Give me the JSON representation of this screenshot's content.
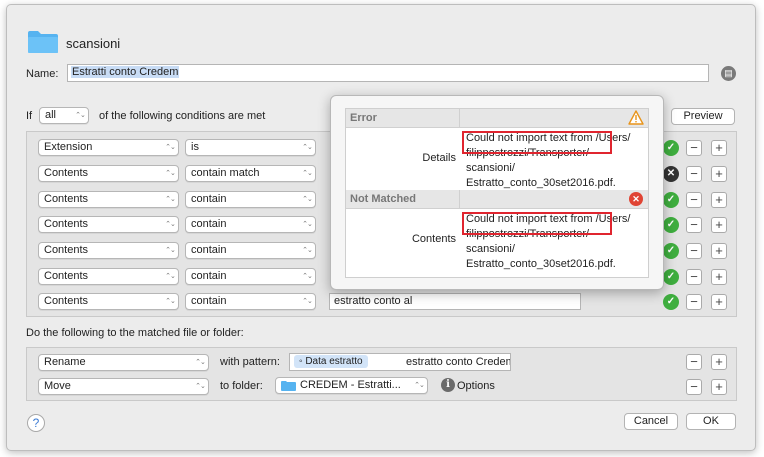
{
  "header": {
    "folder_name": "scansioni",
    "name_label": "Name:",
    "name_value": "Estratti conto Credem"
  },
  "conditions_header": {
    "if": "If",
    "match_mode": "all",
    "tail": "of the following conditions are met",
    "preview": "Preview"
  },
  "conditions": [
    {
      "attribute": "Extension",
      "operator": "is",
      "value": ""
    },
    {
      "attribute": "Contents",
      "operator": "contain match",
      "value": ""
    },
    {
      "attribute": "Contents",
      "operator": "contain",
      "value": ""
    },
    {
      "attribute": "Contents",
      "operator": "contain",
      "value": ""
    },
    {
      "attribute": "Contents",
      "operator": "contain",
      "value": ""
    },
    {
      "attribute": "Contents",
      "operator": "contain",
      "value": ""
    },
    {
      "attribute": "Contents",
      "operator": "contain",
      "value": "estratto conto al"
    }
  ],
  "actions_header": "Do the following to the matched file or folder:",
  "actions": [
    {
      "action": "Rename",
      "connector": "with pattern:",
      "token": "Data estratto",
      "pattern_text": "estratto conto Credem"
    },
    {
      "action": "Move",
      "connector": "to folder:",
      "folder": "CREDEM - Estratti...",
      "options": "Options"
    }
  ],
  "footer": {
    "help": "?",
    "cancel": "Cancel",
    "ok": "OK"
  },
  "popover": {
    "error_section": {
      "title": "Error",
      "key": "Details",
      "lines": [
        "Could not import text from /Users/",
        "filippostrozzi/Transporter/",
        "scansioni/",
        "Estratto_conto_30set2016.pdf."
      ]
    },
    "notmatched_section": {
      "title": "Not Matched",
      "key": "Contents",
      "lines": [
        "Could not import text from /Users/",
        "filippostrozzi/Transporter/",
        "scansioni/",
        "Estratto_conto_30set2016.pdf."
      ]
    }
  },
  "colors": {
    "check": "#3fae3f",
    "error_red": "#e0252f",
    "warning": "#f0a020",
    "token_bg": "#d2e4f8"
  },
  "icons": [
    "folder-icon",
    "document-icon",
    "check-icon",
    "minus-icon",
    "plus-icon",
    "warning-icon",
    "error-icon",
    "info-icon",
    "help-icon",
    "clear-icon"
  ]
}
